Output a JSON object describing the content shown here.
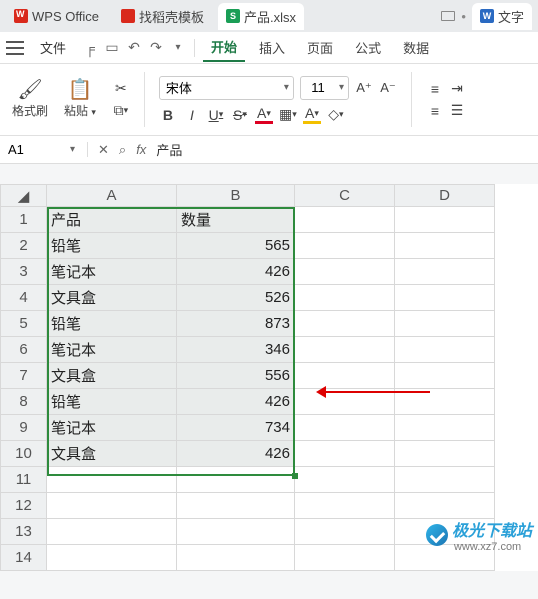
{
  "apptabs": {
    "wps": "WPS Office",
    "tpl": "找稻壳模板",
    "xls_icon": "S",
    "xls": "产品.xlsx",
    "doc_icon": "W",
    "doc": "文字"
  },
  "menubar": {
    "file": "文件",
    "items": [
      "开始",
      "插入",
      "页面",
      "公式",
      "数据"
    ],
    "active_index": 0
  },
  "ribbon": {
    "format_painter": "格式刷",
    "paste": "粘贴",
    "font_name": "宋体",
    "font_size": "11",
    "a_plus": "A⁺",
    "a_minus": "A⁻",
    "bold": "B",
    "italic": "I",
    "underline": "U",
    "strike": "S",
    "font_color": "A",
    "fill": "A"
  },
  "formula_bar": {
    "name": "A1",
    "fx": "fx",
    "value": "产品"
  },
  "columns": [
    "A",
    "B",
    "C",
    "D"
  ],
  "rows": [
    "1",
    "2",
    "3",
    "4",
    "5",
    "6",
    "7",
    "8",
    "9",
    "10",
    "11",
    "12",
    "13",
    "14"
  ],
  "cells": {
    "header": {
      "a": "产品",
      "b": "数量"
    },
    "data": [
      {
        "a": "铅笔",
        "b": "565"
      },
      {
        "a": "笔记本",
        "b": "426"
      },
      {
        "a": "文具盒",
        "b": "526"
      },
      {
        "a": "铅笔",
        "b": "873"
      },
      {
        "a": "笔记本",
        "b": "346"
      },
      {
        "a": "文具盒",
        "b": "556"
      },
      {
        "a": "铅笔",
        "b": "426"
      },
      {
        "a": "笔记本",
        "b": "734"
      },
      {
        "a": "文具盒",
        "b": "426"
      }
    ]
  },
  "watermark": {
    "main": "极光下载站",
    "sub": "www.xz7.com"
  }
}
